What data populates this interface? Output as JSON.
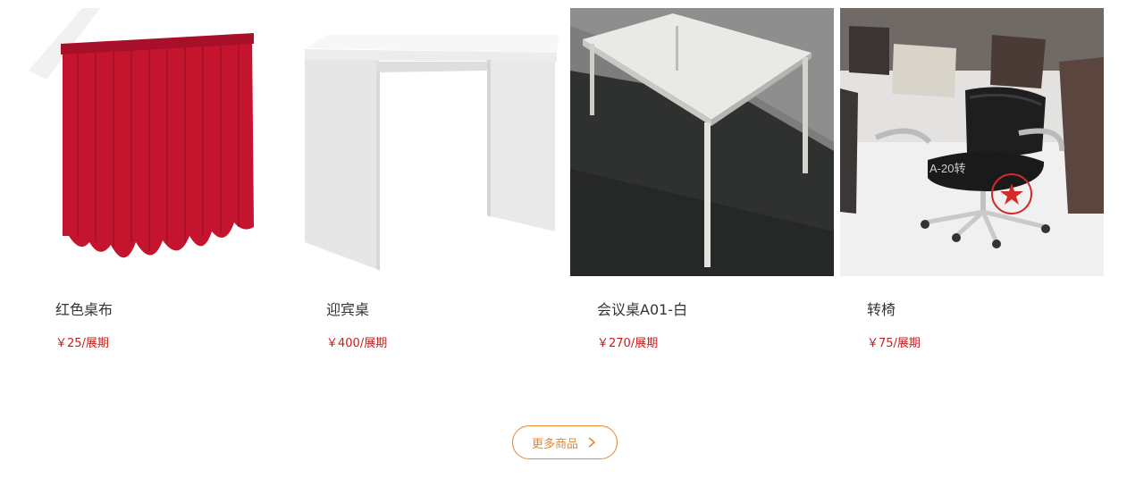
{
  "products": [
    {
      "name": "红色桌布",
      "price": "￥25/展期",
      "image_icon": "red-tablecloth-image"
    },
    {
      "name": "迎宾桌",
      "price": "￥400/展期",
      "image_icon": "white-reception-table-image"
    },
    {
      "name": "会议桌A01-白",
      "price": "￥270/展期",
      "image_icon": "white-meeting-table-image"
    },
    {
      "name": "转椅",
      "price": "￥75/展期",
      "image_icon": "swivel-chair-image",
      "image_label": "A-20转"
    }
  ],
  "more_button": {
    "label": "更多商品",
    "icon": "chevron-right-icon"
  },
  "colors": {
    "accent": "#e8862a",
    "price": "#c81d1d",
    "text": "#333333"
  }
}
